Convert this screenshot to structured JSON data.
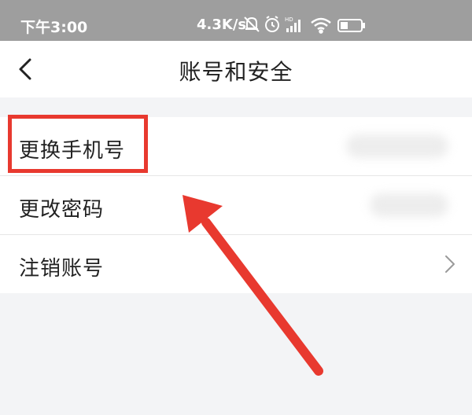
{
  "status_bar": {
    "time": "下午3:00",
    "network_speed": "4.3K/s",
    "icons": [
      "mute-bell-icon",
      "alarm-icon",
      "hd-signal-icon",
      "wifi-icon",
      "battery-icon"
    ]
  },
  "header": {
    "back_icon": "chevron-left-icon",
    "title": "账号和安全"
  },
  "list": {
    "items": [
      {
        "label": "更换手机号",
        "value_blurred": true
      },
      {
        "label": "更改密码",
        "value_blurred": true
      },
      {
        "label": "注销账号",
        "chevron": "chevron-right-icon"
      }
    ]
  },
  "annotation": {
    "highlight_color": "#e8392f",
    "arrow_color": "#e8392f"
  }
}
